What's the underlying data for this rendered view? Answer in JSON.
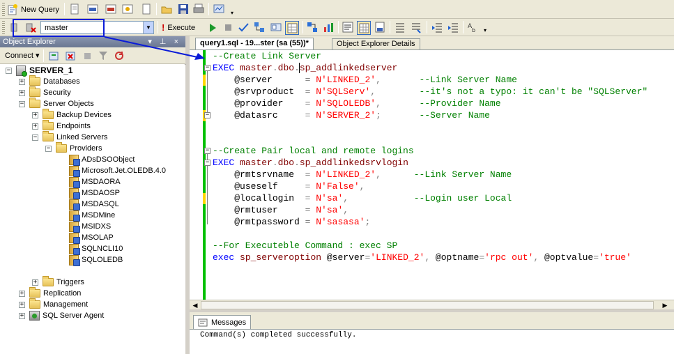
{
  "toolbar1": {
    "new_query_label": "New Query",
    "icons": [
      "new-query-icon",
      "open-query-icon",
      "database-engine-query-icon",
      "analysis-query-icon",
      "dmx-query-icon",
      "new-file-icon",
      "open-file-icon",
      "save-icon",
      "print-icon",
      "activity-monitor-icon"
    ]
  },
  "toolbar2": {
    "database_value": "master",
    "execute_label": "Execute"
  },
  "object_explorer": {
    "title": "Object Explorer",
    "connect_label": "Connect ▾",
    "pin_glyph": "▾ ⊥ ×",
    "server": "SERVER_1",
    "nodes": {
      "databases": "Databases",
      "security": "Security",
      "server_objects": "Server Objects",
      "backup_devices": "Backup Devices",
      "endpoints": "Endpoints",
      "linked_servers": "Linked Servers",
      "providers": "Providers",
      "triggers": "Triggers",
      "replication": "Replication",
      "management": "Management",
      "agent": "SQL Server Agent"
    },
    "providers": [
      "ADsDSOObject",
      "Microsoft.Jet.OLEDB.4.0",
      "MSDAORA",
      "MSDAOSP",
      "MSDASQL",
      "MSDMine",
      "MSIDXS",
      "MSOLAP",
      "SQLNCLI10",
      "SQLOLEDB"
    ]
  },
  "editor_tabs": {
    "active": "query1.sql - 19...ster (sa (55))*",
    "inactive": "Object Explorer Details"
  },
  "code": {
    "l1_comment": "--Create Link Server",
    "l2_exec": "EXEC",
    "l2_obj": "master",
    "l2_dot1": ".",
    "l2_dbo": "dbo",
    "l2_dot2": ".",
    "l2_proc": "sp_addlinkedserver",
    "l3_param": "@server",
    "l3_eq": "      = ",
    "l3_val": "N'LINKED_2'",
    "l3_comma": ",",
    "l3_cm": "--Link Server Name",
    "l4_param": "@srvproduct",
    "l4_eq": "  = ",
    "l4_val": "N'SQLServ'",
    "l4_comma": ",",
    "l4_cm": "--it's not a typo: it can't be \"SQLServer\"",
    "l5_param": "@provider",
    "l5_eq": "    = ",
    "l5_val": "N'SQLOLEDB'",
    "l5_comma": ",",
    "l5_cm": "--Provider Name",
    "l6_param": "@datasrc",
    "l6_eq": "     = ",
    "l6_val": "N'SERVER_2'",
    "l6_comma": ";",
    "l6_cm": "--Server Name",
    "l7_comment": "--Create Pair local and remote logins",
    "l8_exec": "EXEC",
    "l8_obj": "master",
    "l8_dot1": ".",
    "l8_dbo": "dbo",
    "l8_dot2": ".",
    "l8_proc": "sp_addlinkedsrvlogin",
    "l9_param": "@rmtsrvname",
    "l9_eq": "  = ",
    "l9_val": "N'LINKED_2'",
    "l9_comma": ",",
    "l9_cm": "--Link Server Name",
    "l10_param": "@useself",
    "l10_eq": "     = ",
    "l10_val": "N'False'",
    "l10_comma": ",",
    "l11_param": "@locallogin",
    "l11_eq": "  = ",
    "l11_val": "N'sa'",
    "l11_comma": ",",
    "l11_cm": "--Login user Local",
    "l12_param": "@rmtuser",
    "l12_eq": "     = ",
    "l12_val": "N'sa'",
    "l12_comma": ",",
    "l13_param": "@rmtpassword",
    "l13_eq": " = ",
    "l13_val": "N'sasasa'",
    "l13_comma": ";",
    "l14_comment": "--For Executeble Command : exec SP",
    "l15_exec": "exec",
    "l15_proc": "sp_serveroption",
    "l15_p1": "@server",
    "l15_eq1": "=",
    "l15_v1": "'LINKED_2'",
    "l15_c1": ", ",
    "l15_p2": "@optname",
    "l15_eq2": "=",
    "l15_v2": "'rpc out'",
    "l15_c2": ", ",
    "l15_p3": "@optvalue",
    "l15_eq3": "=",
    "l15_v3": "'true'"
  },
  "messages": {
    "tab_label": "Messages",
    "text": "Command(s) completed successfully."
  },
  "colors": {
    "keyword": "#0000ff",
    "string": "#ff0000",
    "comment": "#008000",
    "annotation": "#0a1bd8"
  }
}
